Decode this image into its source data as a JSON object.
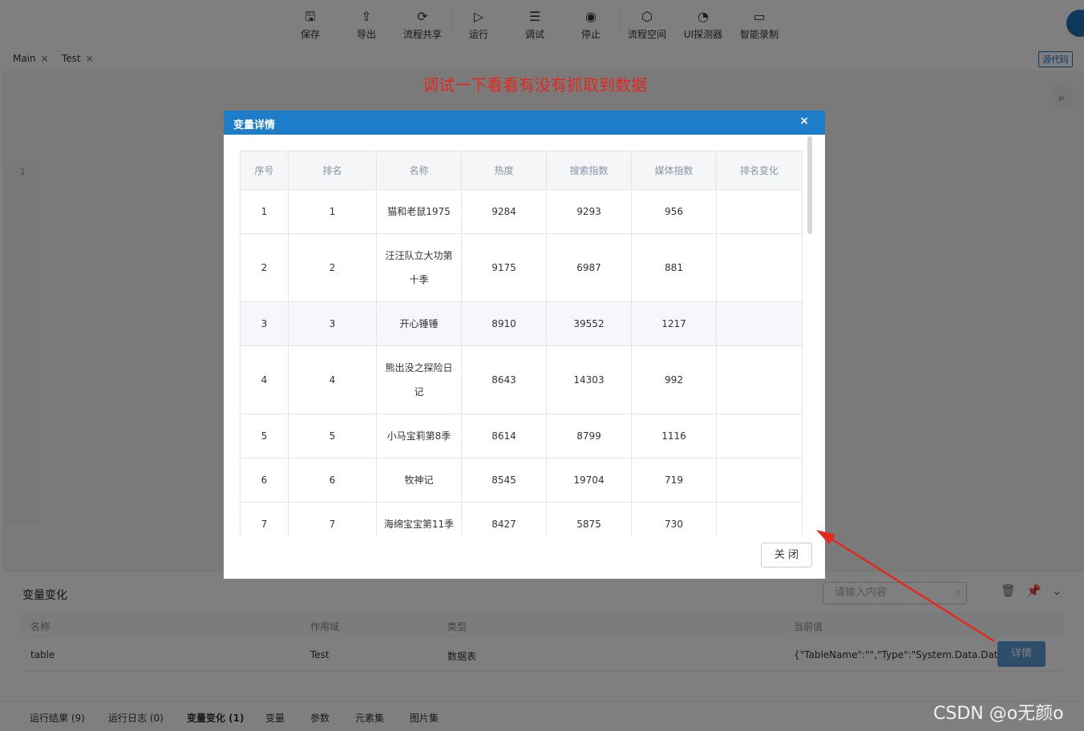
{
  "toolbar": {
    "items": [
      {
        "label": "保存",
        "icon": "save-icon",
        "glyph": "🖫"
      },
      {
        "label": "导出",
        "icon": "export-icon",
        "glyph": "⇪"
      },
      {
        "label": "流程共享",
        "icon": "share-icon",
        "glyph": "⟳"
      },
      {
        "label": "运行",
        "icon": "run-icon",
        "glyph": "▷"
      },
      {
        "label": "调试",
        "icon": "debug-icon",
        "glyph": "☰"
      },
      {
        "label": "停止",
        "icon": "stop-icon",
        "glyph": "◉"
      },
      {
        "label": "流程空间",
        "icon": "cube-icon",
        "glyph": "⬡"
      },
      {
        "label": "UI探测器",
        "icon": "detector-icon",
        "glyph": "◔"
      },
      {
        "label": "智能录制",
        "icon": "record-icon",
        "glyph": "▭"
      }
    ]
  },
  "tabs": [
    {
      "label": "Main"
    },
    {
      "label": "Test"
    }
  ],
  "source_button": "源代码",
  "editor": {
    "line_number": "1"
  },
  "annotation": "调试一下看看有没有抓取到数据",
  "modal": {
    "title": "变量详情",
    "close_icon": "×",
    "columns": [
      "序号",
      "排名",
      "名称",
      "热度",
      "搜索指数",
      "媒体指数",
      "排名变化"
    ],
    "rows": [
      [
        "1",
        "1",
        "猫和老鼠1975",
        "9284",
        "9293",
        "956",
        ""
      ],
      [
        "2",
        "2",
        "汪汪队立大功第十季",
        "9175",
        "6987",
        "881",
        ""
      ],
      [
        "3",
        "3",
        "开心锤锤",
        "8910",
        "39552",
        "1217",
        ""
      ],
      [
        "4",
        "4",
        "熊出没之探险日记",
        "8643",
        "14303",
        "992",
        ""
      ],
      [
        "5",
        "5",
        "小马宝莉第8季",
        "8614",
        "8799",
        "1116",
        ""
      ],
      [
        "6",
        "6",
        "牧神记",
        "8545",
        "19704",
        "719",
        ""
      ],
      [
        "7",
        "7",
        "海绵宝宝第11季",
        "8427",
        "5875",
        "730",
        ""
      ]
    ],
    "close_button": "关 闭"
  },
  "variables_panel": {
    "title": "变量变化",
    "search_placeholder": "请输入内容",
    "columns": [
      "名称",
      "作用域",
      "类型",
      "当前值"
    ],
    "row": {
      "name": "table",
      "scope": "Test",
      "type": "数据表",
      "value": "{\"TableName\":\"\",\"Type\":\"System.Data.DataTa..."
    },
    "detail_button": "详情"
  },
  "bottom_tabs": [
    "运行结果 (9)",
    "运行日志 (0)",
    "变量变化 (1)",
    "变量",
    "参数",
    "元素集",
    "图片集"
  ],
  "watermark": "CSDN @o无颜o",
  "colors": {
    "accent": "#1e7dc8",
    "annotation": "#e4281f"
  }
}
